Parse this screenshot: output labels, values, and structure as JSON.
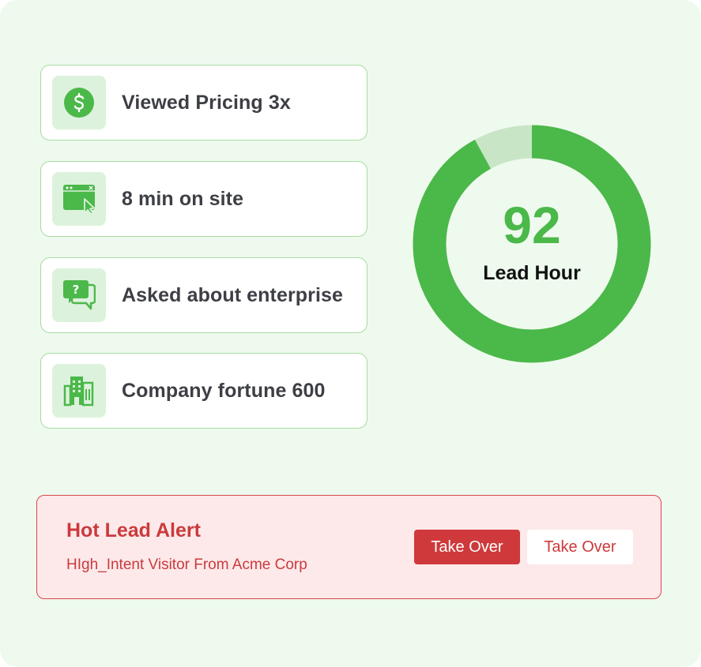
{
  "colors": {
    "background": "#effaee",
    "accent_green": "#4bb84a",
    "ring_remainder": "#c8e6c6",
    "alert_red": "#cb3a3c",
    "alert_bg": "#fde9ea"
  },
  "signals": [
    {
      "label": "Viewed Pricing 3x",
      "icon": "dollar-icon"
    },
    {
      "label": "8 min on site",
      "icon": "browser-cursor-icon"
    },
    {
      "label": "Asked about enterprise",
      "icon": "chat-question-icon"
    },
    {
      "label": "Company fortune 600",
      "icon": "building-icon"
    }
  ],
  "score": {
    "value": "92",
    "label": "Lead Hour",
    "fill_fraction": 0.92
  },
  "alert": {
    "title": "Hot Lead Alert",
    "subtitle": "HIgh_Intent Visitor From Acme Corp",
    "primary_button": "Take Over",
    "secondary_button": "Take Over"
  }
}
